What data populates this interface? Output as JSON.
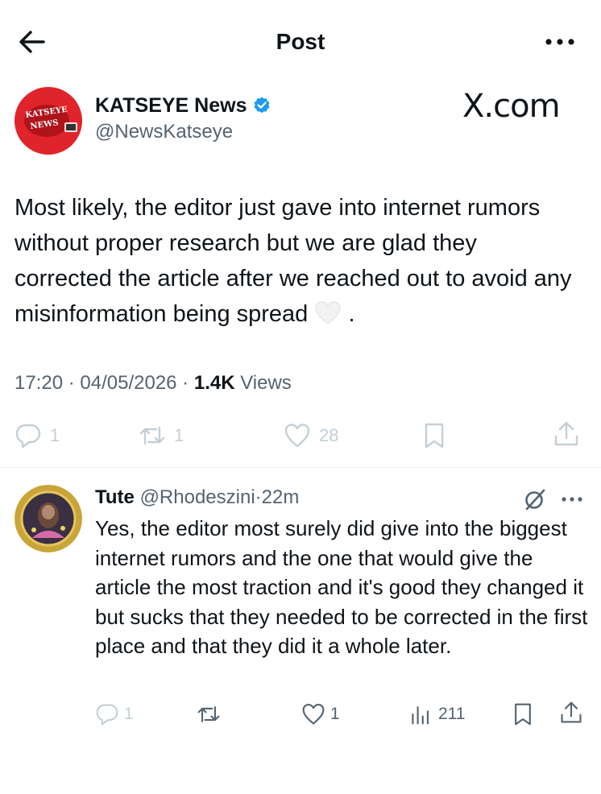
{
  "header": {
    "title": "Post"
  },
  "post": {
    "author_name": "KATSEYE News",
    "author_handle": "@NewsKatseye",
    "watermark": "X.com",
    "avatar_text": "KATSEYE NEWS",
    "text": "Most likely, the editor just gave into internet rumors without proper research but we are glad they corrected the article after we reached out to avoid any misinformation being spread",
    "text_end": ".",
    "emoji": "white-heart",
    "time": "17:20",
    "date": "04/05/2026",
    "views_count": "1.4K",
    "views_label": "Views",
    "replies": "1",
    "reposts": "1",
    "likes": "28"
  },
  "reply": {
    "name": "Tute",
    "handle": "@Rhodeszini",
    "time": "22m",
    "text": "Yes, the editor most surely did give into the biggest internet rumors and the one that would give the article the most traction and it's good they changed it but sucks that they needed to be corrected in the first place and that they did it a whole later.",
    "replies": "1",
    "likes": "1",
    "views": "211"
  },
  "colors": {
    "text": "#0f1419",
    "secondary": "#536471",
    "faded": "#c4cfd6",
    "verified": "#1d9bf0",
    "divider": "#eff3f4"
  }
}
